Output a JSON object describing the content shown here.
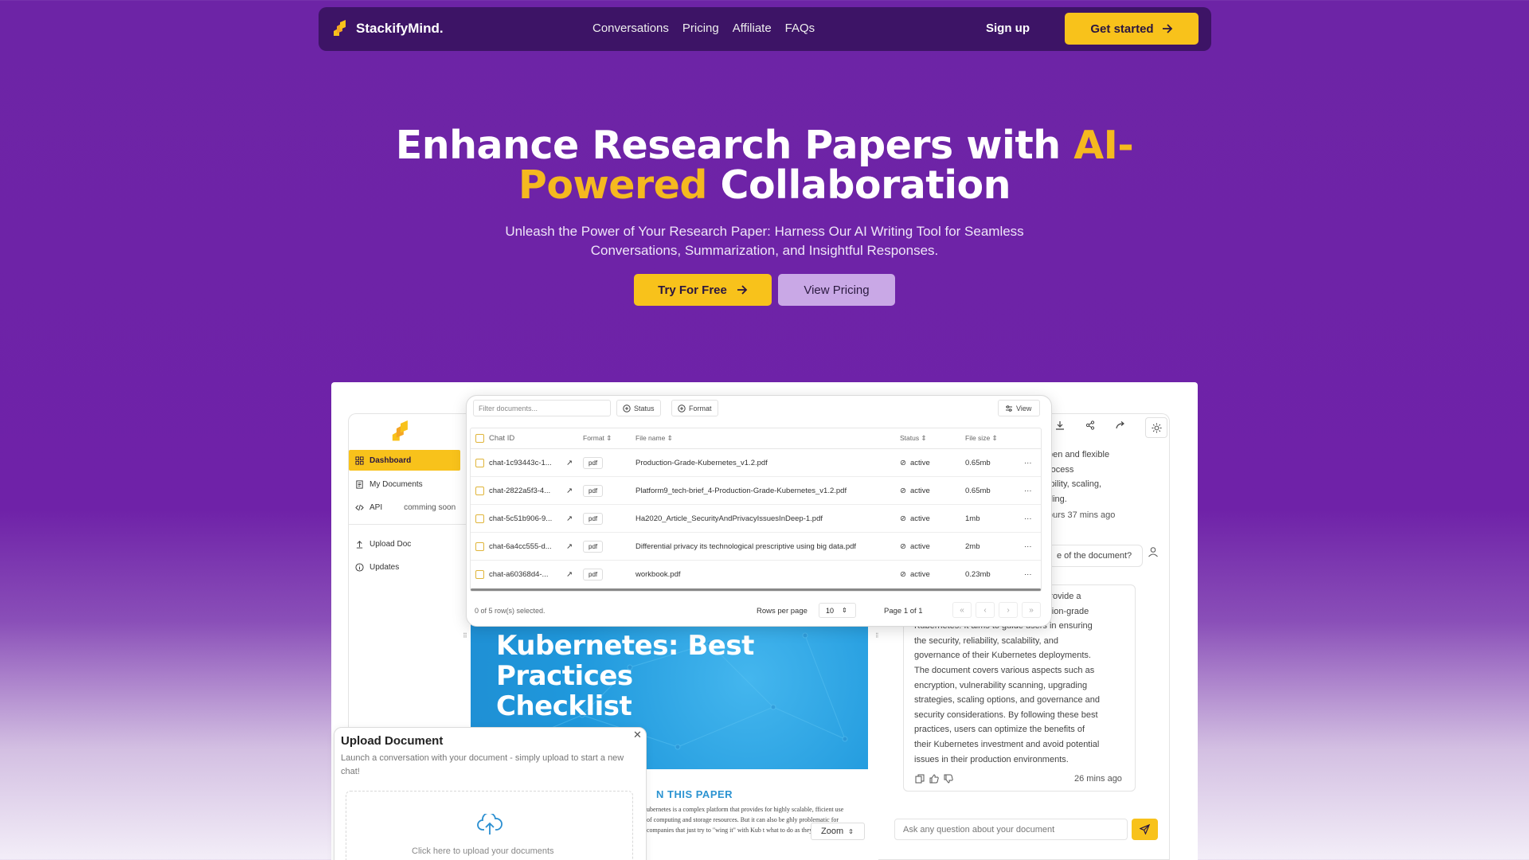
{
  "nav": {
    "brand": "StackifyMind.",
    "links": [
      "Conversations",
      "Pricing",
      "Affiliate",
      "FAQs"
    ],
    "signup": "Sign up",
    "cta": "Get started"
  },
  "hero": {
    "title_part1": "Enhance Research Papers with ",
    "title_accent1": "AI-",
    "title_accent2": "Powered",
    "title_part2": " Collaboration",
    "subtitle": "Unleash the Power of Your Research Paper: Harness Our AI Writing Tool for Seamless Conversations, Summarization, and Insightful Responses.",
    "try_btn": "Try For Free",
    "pricing_btn": "View Pricing"
  },
  "sidebar": {
    "items": [
      {
        "label": "Dashboard",
        "icon": "dashboard-icon"
      },
      {
        "label": "My Documents",
        "icon": "document-icon"
      },
      {
        "label": "API",
        "icon": "code-icon",
        "badge": "comming soon"
      },
      {
        "label": "Upload Doc",
        "icon": "upload-icon"
      },
      {
        "label": "Updates",
        "icon": "info-icon"
      }
    ]
  },
  "table": {
    "filter_placeholder": "Filter documents...",
    "chips": [
      "Status",
      "Format"
    ],
    "view": "View",
    "headers": {
      "id": "Chat ID",
      "format": "Format",
      "file": "File name",
      "status": "Status",
      "size": "File size"
    },
    "rows": [
      {
        "id": "chat-1c93443c-1...",
        "format": "pdf",
        "file": "Production-Grade-Kubernetes_v1.2.pdf",
        "status": "active",
        "size": "0.65mb"
      },
      {
        "id": "chat-2822a5f3-4...",
        "format": "pdf",
        "file": "Platform9_tech-brief_4-Production-Grade-Kubernetes_v1.2.pdf",
        "status": "active",
        "size": "0.65mb"
      },
      {
        "id": "chat-5c51b906-9...",
        "format": "pdf",
        "file": "Ha2020_Article_SecurityAndPrivacyIssuesInDeep-1.pdf",
        "status": "active",
        "size": "1mb"
      },
      {
        "id": "chat-6a4cc555-d...",
        "format": "pdf",
        "file": "Differential privacy its technological prescriptive using big data.pdf",
        "status": "active",
        "size": "2mb"
      },
      {
        "id": "chat-a60368d4-...",
        "format": "pdf",
        "file": "workbook.pdf",
        "status": "active",
        "size": "0.23mb"
      }
    ],
    "selected": "0 of 5 row(s) selected.",
    "rows_per_page_label": "Rows per page",
    "rows_per_page": "10",
    "page": "Page 1 of 1"
  },
  "doc": {
    "title": "Kubernetes: Best Practices Checklist",
    "section": "N THIS PAPER",
    "text": "ubernetes is a complex platform that provides for highly scalable, fficient use of computing and storage resources. But it can also be ghly problematic for companies that just try to \"wing it\" with Kub t what to do as they go along.",
    "zoom": "Zoom"
  },
  "chat": {
    "msg1": [
      "pen and flexible",
      "rocess",
      "ibility, scaling,",
      "ding."
    ],
    "msg1_time": "ours 37 mins ago",
    "question": "e of the document?",
    "answer_lines": [
      "to provide a",
      "duction-grade",
      "Kubernetes. It aims to guide users in ensuring",
      "the security, reliability, scalability, and",
      "governance of their Kubernetes deployments.",
      "The document covers various aspects such as",
      "encryption, vulnerability scanning, upgrading",
      "strategies, scaling options, and governance and",
      "security considerations. By following these best",
      "practices, users can optimize the benefits of",
      "their Kubernetes investment and avoid potential",
      "issues in their production environments."
    ],
    "answer_time": "26 mins ago",
    "input_placeholder": "Ask any question about your document"
  },
  "upload": {
    "title": "Upload Document",
    "desc": "Launch a conversation with your document - simply upload to start a new chat!",
    "drop": "Click here to upload your documents"
  },
  "colors": {
    "accent": "#f8c21b",
    "purple": "#6d24a6",
    "nav": "#3d1466"
  }
}
